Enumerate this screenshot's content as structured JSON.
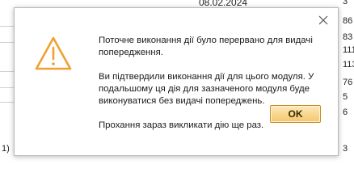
{
  "background": {
    "date": "08.02.2024",
    "right_cells": [
      "3",
      "86",
      "83",
      "111",
      "113",
      "76",
      "5",
      "6",
      "3"
    ],
    "left_row_label": "1)"
  },
  "dialog": {
    "close_icon": "close-icon",
    "warning_icon": "warning-triangle-icon",
    "accent_color": "#f0a030",
    "message": {
      "line1": "Поточне виконання дії було перервано для видачі попередження.",
      "line2": "Ви підтвердили виконання дії для цього модуля. У подальшому ця дія для зазначеного модуля буде виконуватися без видачі попереджень.",
      "line3": "Прохання зараз викликати дію ще раз."
    },
    "ok_label": "OK"
  }
}
